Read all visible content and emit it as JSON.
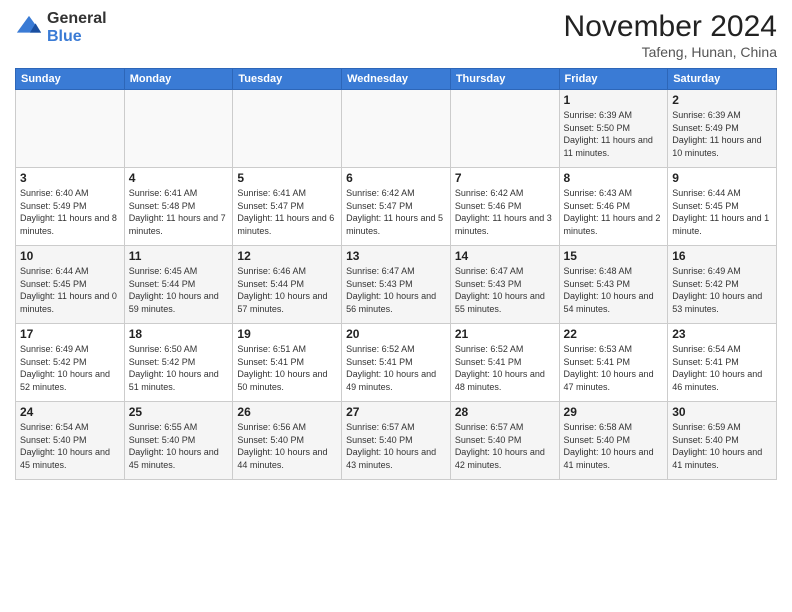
{
  "logo": {
    "general": "General",
    "blue": "Blue"
  },
  "title": "November 2024",
  "location": "Tafeng, Hunan, China",
  "days_of_week": [
    "Sunday",
    "Monday",
    "Tuesday",
    "Wednesday",
    "Thursday",
    "Friday",
    "Saturday"
  ],
  "weeks": [
    [
      {
        "day": "",
        "info": ""
      },
      {
        "day": "",
        "info": ""
      },
      {
        "day": "",
        "info": ""
      },
      {
        "day": "",
        "info": ""
      },
      {
        "day": "",
        "info": ""
      },
      {
        "day": "1",
        "info": "Sunrise: 6:39 AM\nSunset: 5:50 PM\nDaylight: 11 hours and 11 minutes."
      },
      {
        "day": "2",
        "info": "Sunrise: 6:39 AM\nSunset: 5:49 PM\nDaylight: 11 hours and 10 minutes."
      }
    ],
    [
      {
        "day": "3",
        "info": "Sunrise: 6:40 AM\nSunset: 5:49 PM\nDaylight: 11 hours and 8 minutes."
      },
      {
        "day": "4",
        "info": "Sunrise: 6:41 AM\nSunset: 5:48 PM\nDaylight: 11 hours and 7 minutes."
      },
      {
        "day": "5",
        "info": "Sunrise: 6:41 AM\nSunset: 5:47 PM\nDaylight: 11 hours and 6 minutes."
      },
      {
        "day": "6",
        "info": "Sunrise: 6:42 AM\nSunset: 5:47 PM\nDaylight: 11 hours and 5 minutes."
      },
      {
        "day": "7",
        "info": "Sunrise: 6:42 AM\nSunset: 5:46 PM\nDaylight: 11 hours and 3 minutes."
      },
      {
        "day": "8",
        "info": "Sunrise: 6:43 AM\nSunset: 5:46 PM\nDaylight: 11 hours and 2 minutes."
      },
      {
        "day": "9",
        "info": "Sunrise: 6:44 AM\nSunset: 5:45 PM\nDaylight: 11 hours and 1 minute."
      }
    ],
    [
      {
        "day": "10",
        "info": "Sunrise: 6:44 AM\nSunset: 5:45 PM\nDaylight: 11 hours and 0 minutes."
      },
      {
        "day": "11",
        "info": "Sunrise: 6:45 AM\nSunset: 5:44 PM\nDaylight: 10 hours and 59 minutes."
      },
      {
        "day": "12",
        "info": "Sunrise: 6:46 AM\nSunset: 5:44 PM\nDaylight: 10 hours and 57 minutes."
      },
      {
        "day": "13",
        "info": "Sunrise: 6:47 AM\nSunset: 5:43 PM\nDaylight: 10 hours and 56 minutes."
      },
      {
        "day": "14",
        "info": "Sunrise: 6:47 AM\nSunset: 5:43 PM\nDaylight: 10 hours and 55 minutes."
      },
      {
        "day": "15",
        "info": "Sunrise: 6:48 AM\nSunset: 5:43 PM\nDaylight: 10 hours and 54 minutes."
      },
      {
        "day": "16",
        "info": "Sunrise: 6:49 AM\nSunset: 5:42 PM\nDaylight: 10 hours and 53 minutes."
      }
    ],
    [
      {
        "day": "17",
        "info": "Sunrise: 6:49 AM\nSunset: 5:42 PM\nDaylight: 10 hours and 52 minutes."
      },
      {
        "day": "18",
        "info": "Sunrise: 6:50 AM\nSunset: 5:42 PM\nDaylight: 10 hours and 51 minutes."
      },
      {
        "day": "19",
        "info": "Sunrise: 6:51 AM\nSunset: 5:41 PM\nDaylight: 10 hours and 50 minutes."
      },
      {
        "day": "20",
        "info": "Sunrise: 6:52 AM\nSunset: 5:41 PM\nDaylight: 10 hours and 49 minutes."
      },
      {
        "day": "21",
        "info": "Sunrise: 6:52 AM\nSunset: 5:41 PM\nDaylight: 10 hours and 48 minutes."
      },
      {
        "day": "22",
        "info": "Sunrise: 6:53 AM\nSunset: 5:41 PM\nDaylight: 10 hours and 47 minutes."
      },
      {
        "day": "23",
        "info": "Sunrise: 6:54 AM\nSunset: 5:41 PM\nDaylight: 10 hours and 46 minutes."
      }
    ],
    [
      {
        "day": "24",
        "info": "Sunrise: 6:54 AM\nSunset: 5:40 PM\nDaylight: 10 hours and 45 minutes."
      },
      {
        "day": "25",
        "info": "Sunrise: 6:55 AM\nSunset: 5:40 PM\nDaylight: 10 hours and 45 minutes."
      },
      {
        "day": "26",
        "info": "Sunrise: 6:56 AM\nSunset: 5:40 PM\nDaylight: 10 hours and 44 minutes."
      },
      {
        "day": "27",
        "info": "Sunrise: 6:57 AM\nSunset: 5:40 PM\nDaylight: 10 hours and 43 minutes."
      },
      {
        "day": "28",
        "info": "Sunrise: 6:57 AM\nSunset: 5:40 PM\nDaylight: 10 hours and 42 minutes."
      },
      {
        "day": "29",
        "info": "Sunrise: 6:58 AM\nSunset: 5:40 PM\nDaylight: 10 hours and 41 minutes."
      },
      {
        "day": "30",
        "info": "Sunrise: 6:59 AM\nSunset: 5:40 PM\nDaylight: 10 hours and 41 minutes."
      }
    ]
  ]
}
